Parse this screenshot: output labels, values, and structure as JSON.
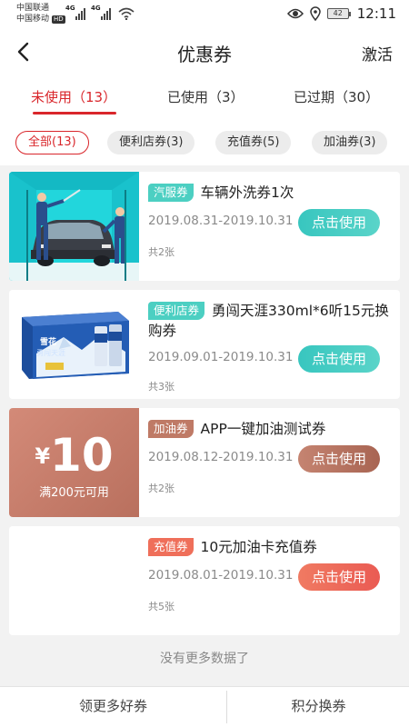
{
  "status_bar": {
    "carrier_1": "中国联通",
    "carrier_2": "中国移动",
    "hd_badge": "HD",
    "network_1": "4G",
    "network_2": "4G",
    "battery": "42",
    "time": "12:11"
  },
  "nav": {
    "title": "优惠券",
    "action": "激活",
    "back_icon": "chevron-left-icon"
  },
  "tabs": [
    {
      "label": "未使用（13）",
      "active": true
    },
    {
      "label": "已使用（3）",
      "active": false
    },
    {
      "label": "已过期（30）",
      "active": false
    }
  ],
  "filters": [
    {
      "label": "全部(13)",
      "active": true
    },
    {
      "label": "便利店券(3)",
      "active": false
    },
    {
      "label": "充值券(5)",
      "active": false
    },
    {
      "label": "加油券(3)",
      "active": false
    }
  ],
  "coupons": [
    {
      "tag": "汽服券",
      "title": "车辆外洗券1次",
      "date": "2019.08.31-2019.10.31",
      "button": "点击使用",
      "count": "共2张",
      "thumb": "car-wash-image"
    },
    {
      "tag": "便利店券",
      "title": "勇闯天涯330ml*6听15元换购券",
      "date": "2019.09.01-2019.10.31",
      "button": "点击使用",
      "count": "共3张",
      "thumb": "beer-pack-image",
      "thumb_text": "雪花",
      "thumb_text_2": "勇闯天涯"
    },
    {
      "tag": "加油券",
      "title": "APP一键加油测试券",
      "date": "2019.08.12-2019.10.31",
      "button": "点击使用",
      "count": "共2张",
      "thumb_currency": "¥",
      "thumb_amount": "10",
      "thumb_condition": "满200元可用"
    },
    {
      "tag": "充值券",
      "title": "10元加油卡充值券",
      "date": "2019.08.01-2019.10.31",
      "button": "点击使用",
      "count": "共5张"
    }
  ],
  "footer_note": "没有更多数据了",
  "bottom_bar": {
    "left": "领更多好券",
    "right": "积分换券"
  },
  "colors": {
    "accent_red": "#d9262b",
    "teal": "#4ccfc2",
    "brown": "#b9705e",
    "coral": "#ef6f5a"
  }
}
